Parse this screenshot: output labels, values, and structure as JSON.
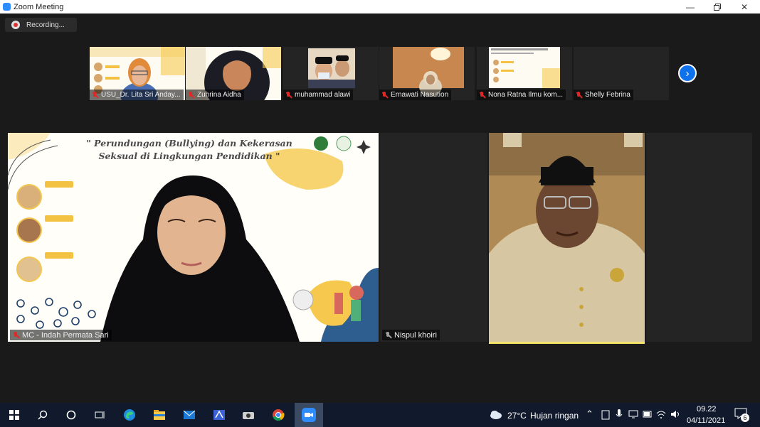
{
  "window": {
    "title": "Zoom Meeting"
  },
  "recording": {
    "label": "Recording..."
  },
  "gallery": [
    {
      "name": "USU_Dr. Lita Sri Anday..."
    },
    {
      "name": "Zuhrina Aidha"
    },
    {
      "name": "muhammad alawi"
    },
    {
      "name": "Ernawati Nasution"
    },
    {
      "name": "Nona Ratna Ilmu kom..."
    },
    {
      "name": "Shelly Febrina"
    }
  ],
  "main_speakers": {
    "left": {
      "name": "MC - Indah Permata Sari"
    },
    "middle": {
      "name": "Nispul khoiri"
    }
  },
  "slide": {
    "title": "\" Perundungan (Bullying) dan Kekerasan Seksual di Lingkungan Pendidikan \""
  },
  "taskbar": {
    "weather_temp": "27°C",
    "weather_desc": "Hujan ringan",
    "time": "09.22",
    "date": "04/11/2021",
    "notification_count": "6"
  },
  "colors": {
    "zoom_blue": "#0e72ed",
    "mic_off_red": "#e02828",
    "taskbar_bg": "#111a2c"
  }
}
